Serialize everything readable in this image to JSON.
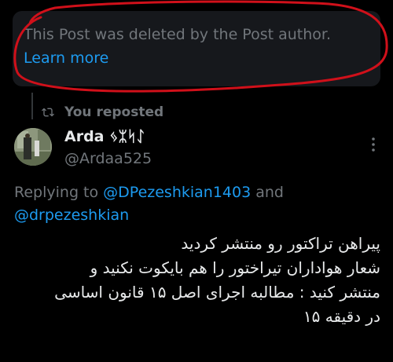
{
  "deleted_notice": {
    "text": "This Post was deleted by the Post author.",
    "link": "Learn more"
  },
  "repost": {
    "label": "You reposted",
    "icon": "repost-icon"
  },
  "author": {
    "name": "Arda ᛃᛯᛋᛇ",
    "handle": "@Ardaa525"
  },
  "reply_context": {
    "prefix": "Replying to ",
    "mention_1": "@DPezeshkian1403",
    "joiner": " and",
    "mention_2": "@drpezeshkian"
  },
  "tweet": {
    "lines": [
      "پیراهن تراکتور رو منتشر کردید",
      "شعار هواداران تیراختور را هم بایکوت نکنید و",
      "منتشر کنید : مطالبه اجرای اصل ۱۵ قانون اساسی",
      "در دقیقه ۱۵"
    ]
  },
  "colors": {
    "background": "#000000",
    "primary_text": "#e7e9ea",
    "secondary_text": "#71767b",
    "link": "#1d9bf0",
    "annotation": "#d0101a"
  }
}
